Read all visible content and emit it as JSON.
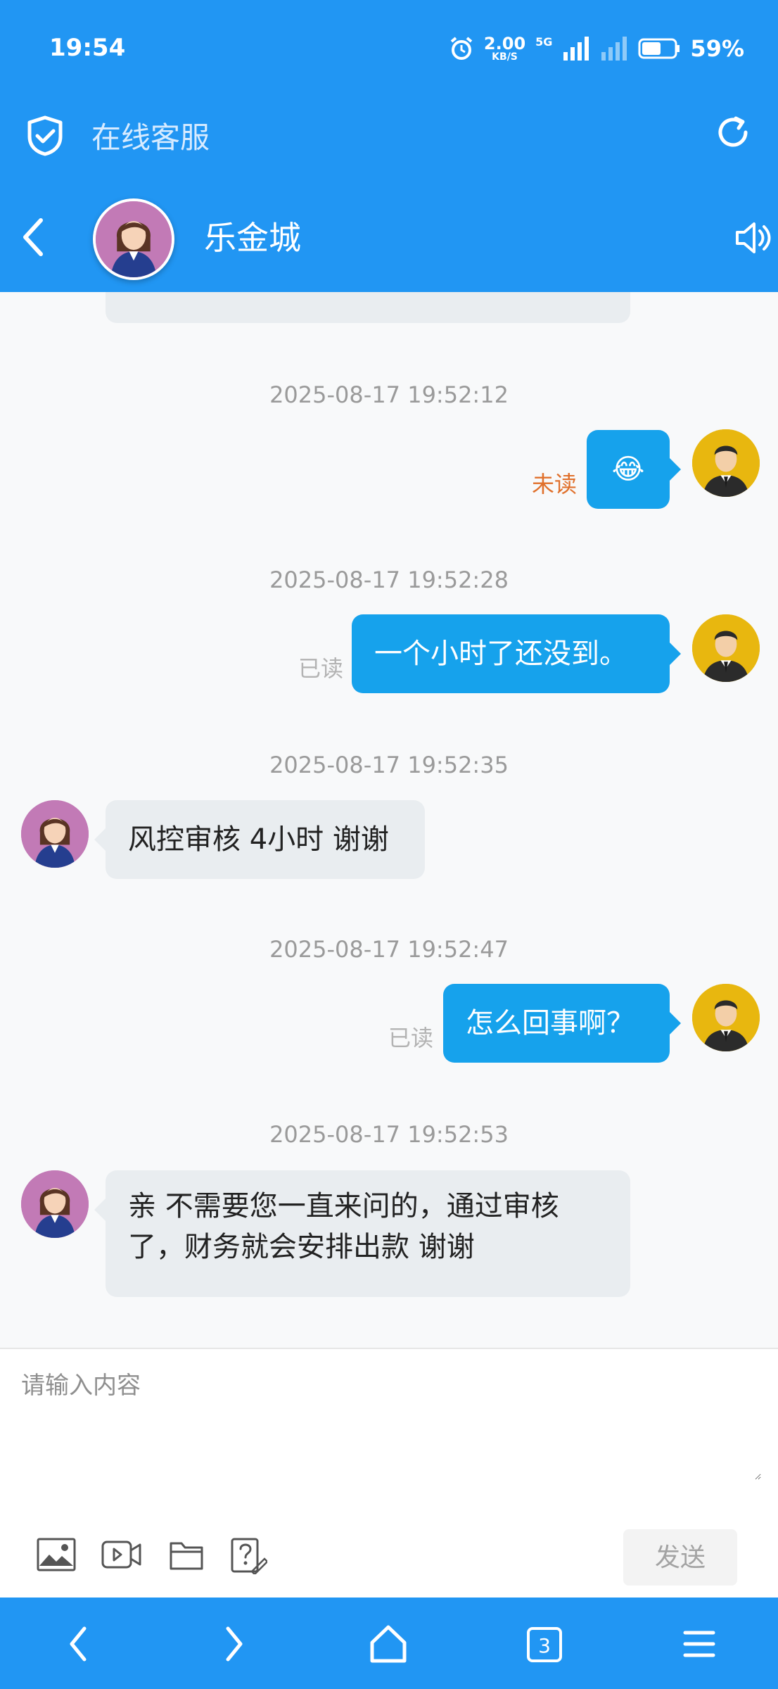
{
  "status_bar": {
    "time": "19:54",
    "network_speed_value": "2.00",
    "network_speed_unit": "KB/S",
    "network_type": "5G",
    "battery": "59%"
  },
  "title_bar": {
    "title": "在线客服"
  },
  "chat_header": {
    "name": "乐金城"
  },
  "messages": [
    {
      "time": "2025-08-17 19:52:12",
      "side": "right",
      "status": "未读",
      "emoji": "😂"
    },
    {
      "time": "2025-08-17 19:52:28",
      "side": "right",
      "status": "已读",
      "text": "一个小时了还没到。"
    },
    {
      "time": "2025-08-17 19:52:35",
      "side": "left",
      "text": "风控审核 4小时 谢谢"
    },
    {
      "time": "2025-08-17 19:52:47",
      "side": "right",
      "status": "已读",
      "text": "怎么回事啊？"
    },
    {
      "time": "2025-08-17 19:52:53",
      "side": "left",
      "text": "亲 不需要您一直来问的，通过审核了，财务就会安排出款 谢谢"
    }
  ],
  "composer": {
    "placeholder": "请输入内容",
    "send_label": "发送",
    "tools": [
      "image-icon",
      "video-icon",
      "folder-icon",
      "faq-icon"
    ]
  },
  "nav_bar": {
    "tab_count": "3",
    "icons": [
      "back-icon",
      "forward-icon",
      "home-icon",
      "tabs-icon",
      "menu-icon"
    ]
  },
  "colors": {
    "primary": "#2196f3",
    "bubble_mine": "#16a2ec",
    "bubble_agent": "#e9edf0",
    "unread": "#e0702b",
    "read": "#b3b3b3"
  }
}
